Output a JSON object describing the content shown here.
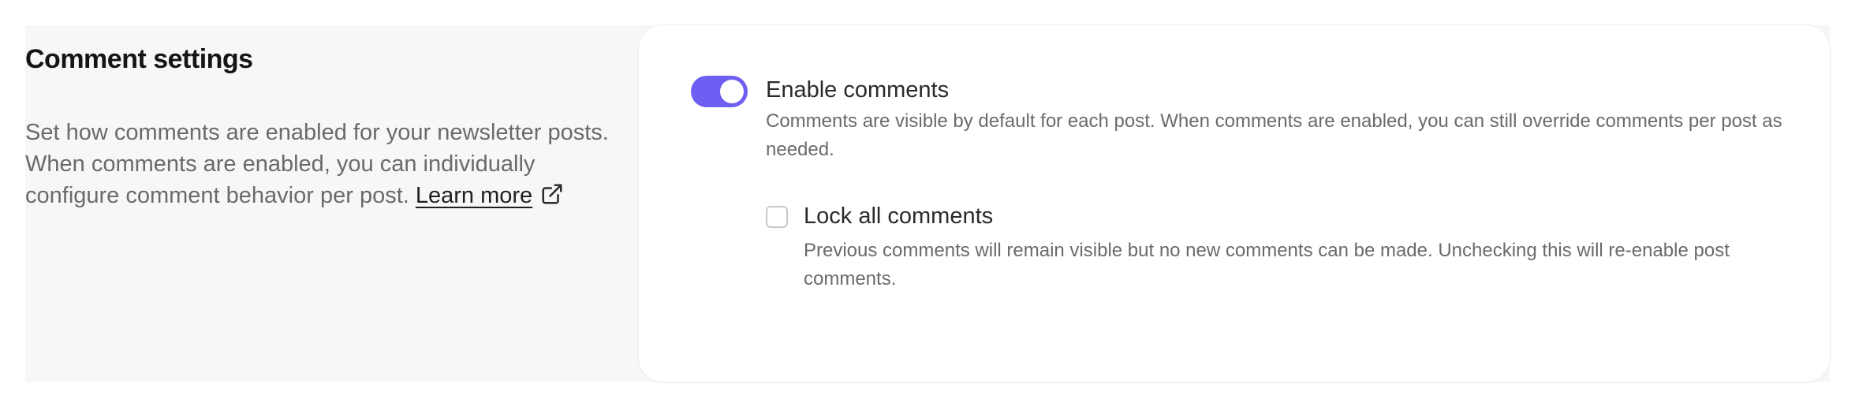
{
  "section": {
    "title": "Comment settings",
    "description": "Set how comments are enabled for your newsletter posts. When comments are enabled, you can individually configure comment behavior per post.",
    "learn_more_label": "Learn more",
    "learn_more_icon": "external-link-icon"
  },
  "enable_comments": {
    "toggle_state": "on",
    "title": "Enable comments",
    "description": "Comments are visible by default for each post. When comments are enabled, you can still override comments per post as needed."
  },
  "lock_comments": {
    "checked": false,
    "title": "Lock all comments",
    "description": "Previous comments will remain visible but no new comments can be made. Unchecking this will re-enable post comments."
  },
  "colors": {
    "accent": "#6f5ef2",
    "panel_background": "#f7f7f7",
    "card_background": "#ffffff",
    "muted_text": "#6a6a6a"
  }
}
